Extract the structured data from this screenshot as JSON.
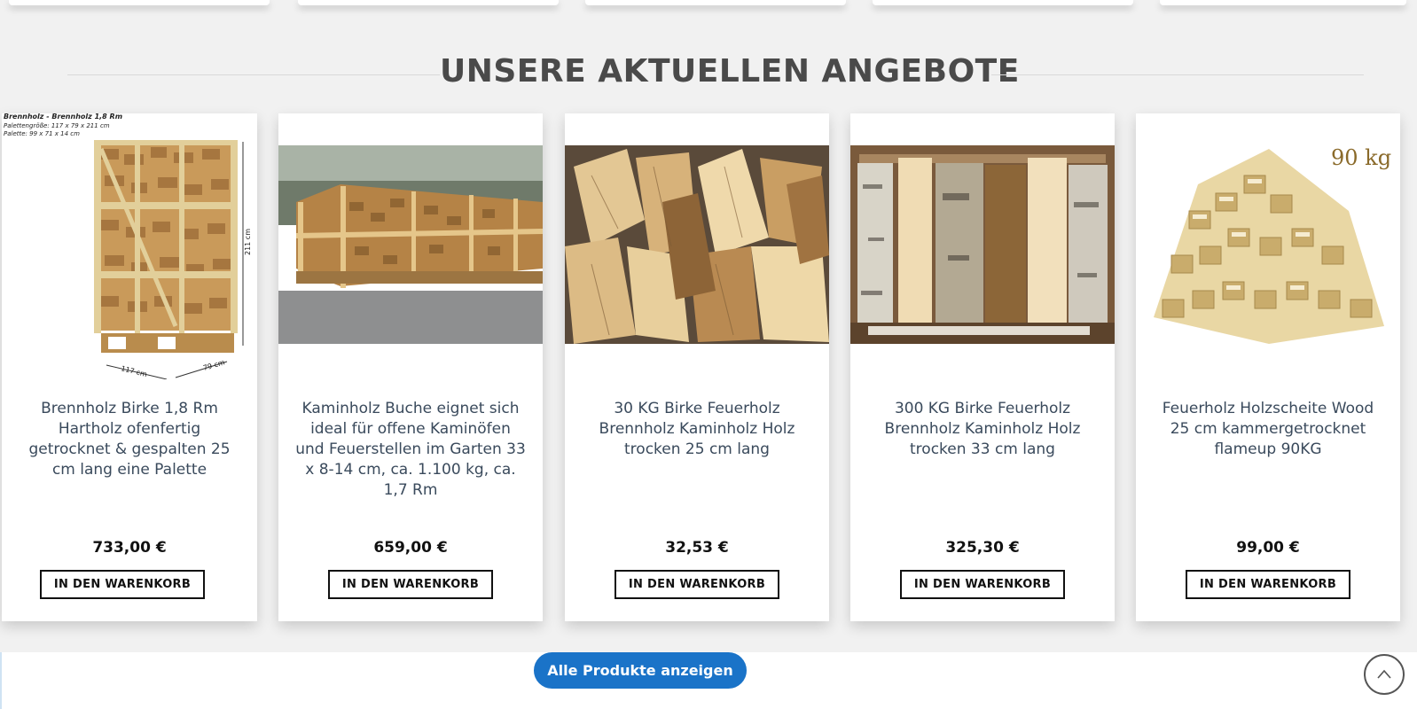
{
  "section": {
    "title": "UNSERE AKTUELLEN ANGEBOTE"
  },
  "products": [
    {
      "title": "Brennholz Birke 1,8 Rm Hartholz ofenfertig getrocknet & gespalten 25 cm lang eine Palette",
      "price": "733,00 €",
      "button": "IN DEN WARENKORB",
      "image_icon": "firewood-pallet-icon"
    },
    {
      "title": "Kaminholz Buche eignet sich ideal für offene Kaminöfen und Feuerstellen im Garten 33 x 8-14 cm, ca. 1.100 kg, ca. 1,7 Rm",
      "price": "659,00 €",
      "button": "IN DEN WARENKORB",
      "image_icon": "firewood-pallets-row-icon"
    },
    {
      "title": "30 KG Birke Feuerholz Brennholz Kaminholz Holz trocken 25 cm lang",
      "price": "32,53 €",
      "button": "IN DEN WARENKORB",
      "image_icon": "split-logs-pile-icon"
    },
    {
      "title": "300 KG Birke Feuerholz Brennholz Kaminholz Holz trocken 33 cm lang",
      "price": "325,30 €",
      "button": "IN DEN WARENKORB",
      "image_icon": "birch-logs-box-icon"
    },
    {
      "title": "Feuerholz Holzscheite Wood 25 cm kammergetrocknet flameup 90KG",
      "price": "99,00 €",
      "button": "IN DEN WARENKORB",
      "image_icon": "stacked-wood-blocks-icon"
    }
  ],
  "image_labels": {
    "pallet_caption_1": "Brennholz - Brennholz 1,8 Rm",
    "pallet_caption_2": "Palettengröße: 117 x 79 x 211 cm",
    "pallet_caption_3": "Palette: 99 x 71 x 14 cm",
    "pallet_height": "211 cm",
    "pallet_width": "117 cm",
    "pallet_depth": "79 cm",
    "weight_badge": "90 kg"
  },
  "footer": {
    "all_products_button": "Alle Produkte anzeigen"
  },
  "colors": {
    "accent": "#1a73c8",
    "heading": "#4a4a4a",
    "title_text": "#3a4a5c",
    "section_bg": "#f1f1f1"
  }
}
